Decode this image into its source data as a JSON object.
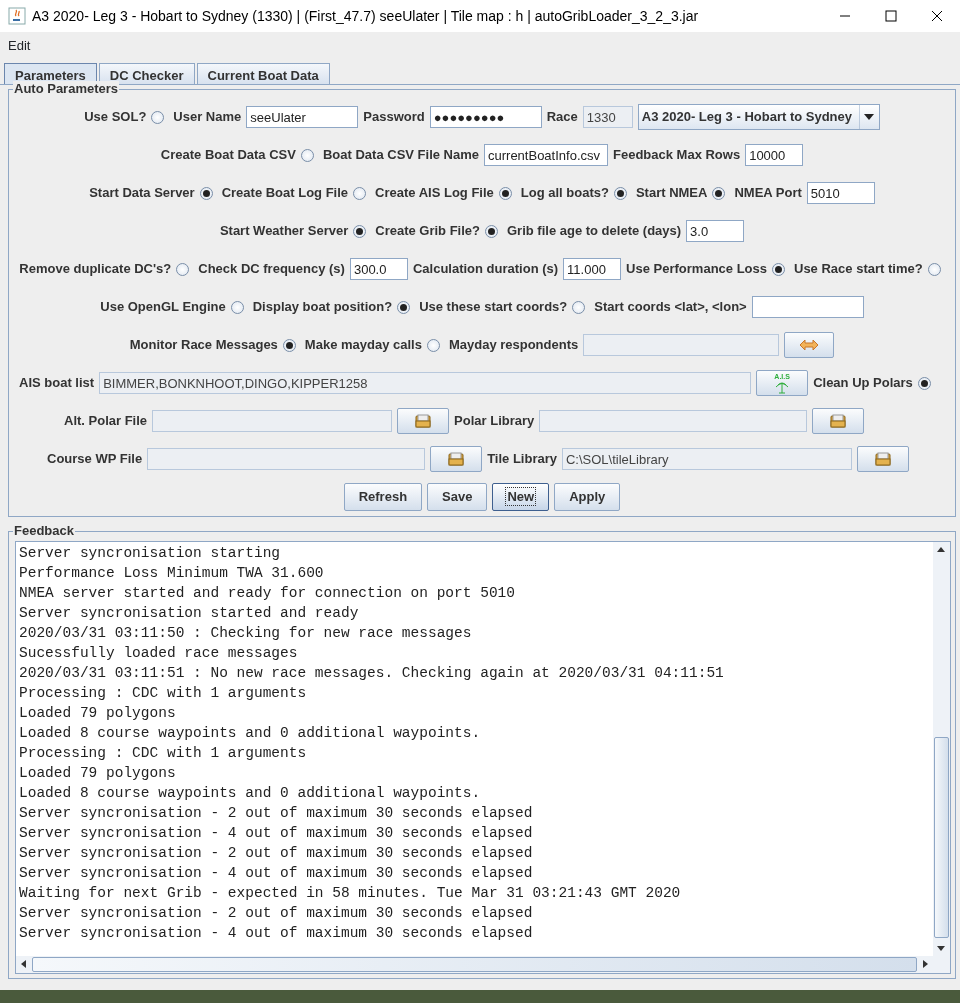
{
  "window": {
    "title": "A3 2020- Leg 3 - Hobart to Sydney (1330) | (First_47.7) seeUlater | Tile map : h | autoGribLoader_3_2_3.jar"
  },
  "menu": [
    "Edit"
  ],
  "tabs": [
    {
      "label": "Parameters",
      "selected": true
    },
    {
      "label": "DC Checker",
      "selected": false
    },
    {
      "label": "Current Boat Data",
      "selected": false
    }
  ],
  "auto_parameters": {
    "title": "Auto Parameters",
    "rows": [
      {
        "items": [
          {
            "kind": "label",
            "text": "Use SOL?"
          },
          {
            "kind": "radio",
            "checked": false
          },
          {
            "kind": "label",
            "text": "User Name"
          },
          {
            "kind": "field",
            "value": "seeUlater",
            "disabled": false
          },
          {
            "kind": "label",
            "text": "Password"
          },
          {
            "kind": "field",
            "value": "●●●●●●●●●",
            "disabled": false
          },
          {
            "kind": "label",
            "text": "Race"
          },
          {
            "kind": "field",
            "value": "1330",
            "disabled": true
          },
          {
            "kind": "combo",
            "value": "A3 2020- Leg 3 - Hobart to Sydney"
          }
        ]
      },
      {
        "items": [
          {
            "kind": "label",
            "text": "Create Boat Data CSV"
          },
          {
            "kind": "radio",
            "checked": false
          },
          {
            "kind": "label",
            "text": "Boat Data CSV File Name"
          },
          {
            "kind": "field",
            "value": "currentBoatInfo.csv",
            "disabled": false
          },
          {
            "kind": "label",
            "text": "Feedback Max Rows"
          },
          {
            "kind": "field",
            "value": "10000",
            "disabled": false
          }
        ]
      },
      {
        "items": [
          {
            "kind": "label",
            "text": "Start Data Server"
          },
          {
            "kind": "radio",
            "checked": true
          },
          {
            "kind": "label",
            "text": "Create Boat Log File"
          },
          {
            "kind": "radio",
            "checked": false
          },
          {
            "kind": "label",
            "text": "Create AIS Log File"
          },
          {
            "kind": "radio",
            "checked": true
          },
          {
            "kind": "label",
            "text": "Log all boats?"
          },
          {
            "kind": "radio",
            "checked": true
          },
          {
            "kind": "label",
            "text": "Start NMEA"
          },
          {
            "kind": "radio",
            "checked": true
          },
          {
            "kind": "label",
            "text": "NMEA Port"
          },
          {
            "kind": "field",
            "value": "5010",
            "disabled": false
          }
        ]
      },
      {
        "items": [
          {
            "kind": "label",
            "text": "Start Weather Server"
          },
          {
            "kind": "radio",
            "checked": true
          },
          {
            "kind": "label",
            "text": "Create Grib File?"
          },
          {
            "kind": "radio",
            "checked": true
          },
          {
            "kind": "label",
            "text": "Grib file age to delete (days)"
          },
          {
            "kind": "field",
            "value": "3.0",
            "disabled": false
          }
        ]
      },
      {
        "items": [
          {
            "kind": "label",
            "text": "Remove duplicate DC's?"
          },
          {
            "kind": "radio",
            "checked": false
          },
          {
            "kind": "label",
            "text": "Check DC frequency (s)"
          },
          {
            "kind": "field",
            "value": "300.0",
            "disabled": false
          },
          {
            "kind": "label",
            "text": "Calculation duration (s)"
          },
          {
            "kind": "field",
            "value": "11.000",
            "disabled": false
          },
          {
            "kind": "label",
            "text": "Use Performance Loss"
          },
          {
            "kind": "radio",
            "checked": true
          },
          {
            "kind": "label",
            "text": "Use Race start time?"
          },
          {
            "kind": "radio",
            "checked": false
          }
        ]
      },
      {
        "items": [
          {
            "kind": "label",
            "text": "Use OpenGL Engine"
          },
          {
            "kind": "radio",
            "checked": false
          },
          {
            "kind": "label",
            "text": "Display boat position?"
          },
          {
            "kind": "radio",
            "checked": true
          },
          {
            "kind": "label",
            "text": "Use these start coords?"
          },
          {
            "kind": "radio",
            "checked": false
          },
          {
            "kind": "label",
            "text": "Start coords <lat>, <lon>"
          },
          {
            "kind": "field",
            "disabled": false
          }
        ]
      },
      {
        "items": [
          {
            "kind": "label",
            "text": "Monitor Race Messages"
          },
          {
            "kind": "radio",
            "checked": true
          },
          {
            "kind": "label",
            "text": "Make mayday calls"
          },
          {
            "kind": "radio",
            "checked": false
          },
          {
            "kind": "label",
            "text": "Mayday respondents"
          },
          {
            "kind": "field",
            "disabled": true
          },
          {
            "kind": "swap_button"
          }
        ]
      },
      {
        "items": [
          {
            "kind": "label",
            "text": "AIS boat list"
          },
          {
            "kind": "field",
            "value": "BIMMER,BONKNHOOT,DINGO,KIPPER1258",
            "disabled": true
          },
          {
            "kind": "ais_button",
            "text": "A.I.S"
          },
          {
            "kind": "label",
            "text": "Clean Up Polars"
          },
          {
            "kind": "radio",
            "checked": true
          }
        ]
      },
      {
        "items": [
          {
            "kind": "label",
            "text": "Alt. Polar File"
          },
          {
            "kind": "field",
            "disabled": true
          },
          {
            "kind": "folder_button"
          },
          {
            "kind": "label",
            "text": "Polar Library"
          },
          {
            "kind": "field",
            "disabled": true
          },
          {
            "kind": "folder_button"
          }
        ]
      },
      {
        "items": [
          {
            "kind": "label",
            "text": "Course WP File"
          },
          {
            "kind": "field",
            "disabled": true
          },
          {
            "kind": "folder_button"
          },
          {
            "kind": "label",
            "text": "Tile Library"
          },
          {
            "kind": "field",
            "value": "C:\\SOL\\tileLibrary",
            "disabled": true
          },
          {
            "kind": "folder_button"
          }
        ]
      },
      {
        "items": [
          {
            "kind": "button",
            "label": "Refresh",
            "focused": false
          },
          {
            "kind": "button",
            "label": "Save",
            "focused": false
          },
          {
            "kind": "button",
            "label": "New",
            "focused": true
          },
          {
            "kind": "button",
            "label": "Apply",
            "focused": false
          }
        ]
      }
    ]
  },
  "feedback": {
    "title": "Feedback",
    "lines": [
      "Server syncronisation starting",
      "Performance Loss Minimum TWA 31.600",
      "NMEA server started and ready for connection on port 5010",
      "Server syncronisation started and ready",
      "2020/03/31 03:11:50 : Checking for new race messages",
      "Sucessfully loaded race messages",
      "2020/03/31 03:11:51 : No new race messages. Checking again at 2020/03/31 04:11:51",
      "Processing : CDC with 1 arguments",
      "Loaded 79 polygons",
      "Loaded 8 course waypoints and 0 additional waypoints.",
      "Processing : CDC with 1 arguments",
      "Loaded 79 polygons",
      "Loaded 8 course waypoints and 0 additional waypoints.",
      "Server syncronisation - 2 out of maximum 30 seconds elapsed",
      "Server syncronisation - 4 out of maximum 30 seconds elapsed",
      "Server syncronisation - 2 out of maximum 30 seconds elapsed",
      "Server syncronisation - 4 out of maximum 30 seconds elapsed",
      "Waiting for next Grib - expected in 58 minutes. Tue Mar 31 03:21:43 GMT 2020",
      "Server syncronisation - 2 out of maximum 30 seconds elapsed",
      "Server syncronisation - 4 out of maximum 30 seconds elapsed"
    ]
  }
}
